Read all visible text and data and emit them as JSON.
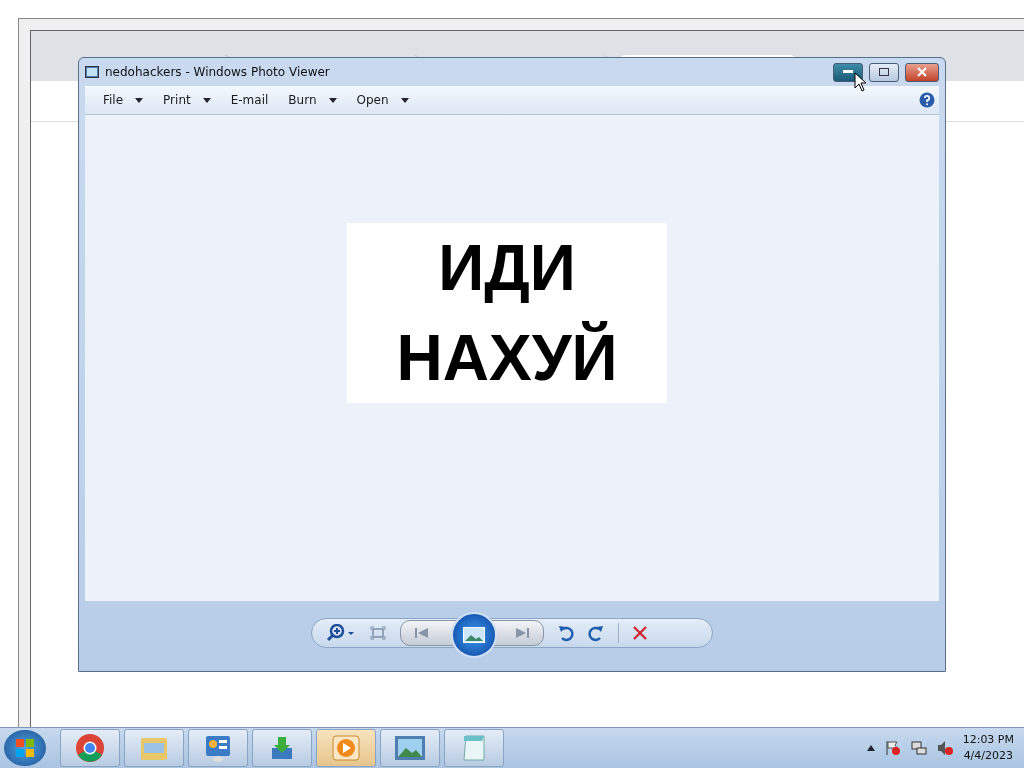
{
  "viewer": {
    "title": "nedohackers - Windows Photo Viewer",
    "menu": [
      {
        "label": "File",
        "dropdown": true
      },
      {
        "label": "Print",
        "dropdown": true
      },
      {
        "label": "E-mail",
        "dropdown": false
      },
      {
        "label": "Burn",
        "dropdown": true
      },
      {
        "label": "Open",
        "dropdown": true
      }
    ],
    "image_lines": [
      "ИДИ",
      "НАХУЙ"
    ]
  },
  "taskbar": {
    "apps": [
      {
        "kind": "chrome",
        "highlighted": false
      },
      {
        "kind": "explorer",
        "highlighted": false
      },
      {
        "kind": "control-panel",
        "highlighted": false
      },
      {
        "kind": "installer",
        "highlighted": false
      },
      {
        "kind": "media-player",
        "highlighted": true
      },
      {
        "kind": "photo-viewer",
        "highlighted": false
      },
      {
        "kind": "notepad",
        "highlighted": false
      }
    ],
    "time": "12:03 PM",
    "date": "4/4/2023"
  }
}
